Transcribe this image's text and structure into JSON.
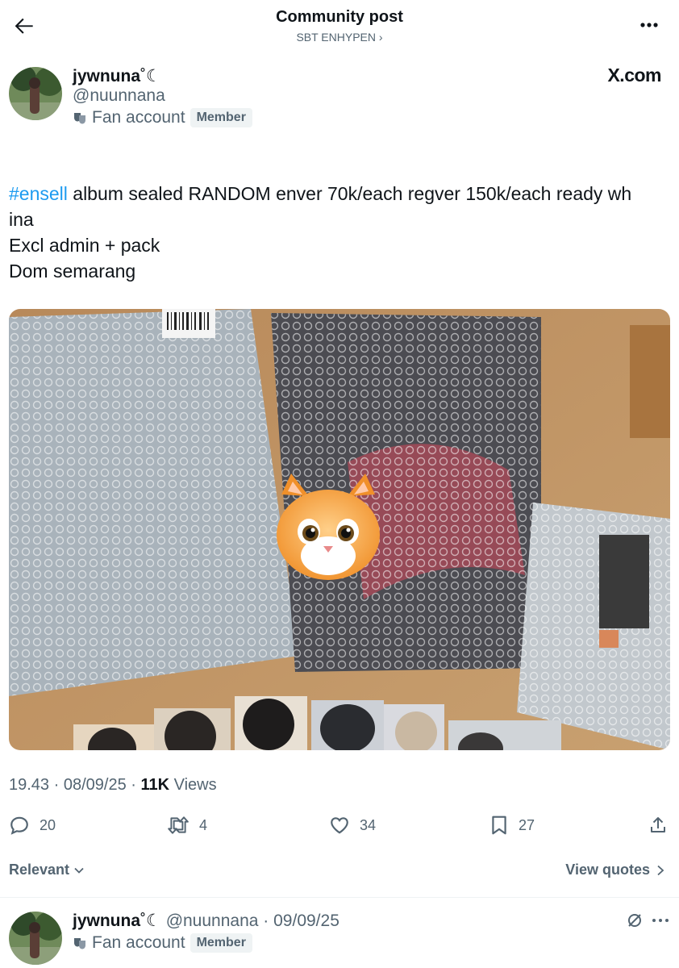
{
  "header": {
    "title": "Community post",
    "subtitle": "SBT ENHYPEN ›"
  },
  "post": {
    "author": {
      "name": "jywnuna",
      "name_glyphs": "˚☾",
      "handle": "@nuunnana",
      "fan_label": "Fan account",
      "badge": "Member"
    },
    "source_label": "X.com",
    "text": {
      "hashtag": "#ensell",
      "line1_rest": " album sealed RANDOM enver 70k/each regver 150k/each ready wh",
      "line2": "ina",
      "line3": "Excl admin + pack",
      "line4": "Dom semarang"
    },
    "meta": {
      "time": "19.43",
      "sep1": " · ",
      "date": "08/09/25",
      "sep2": " · ",
      "views_count": "11K",
      "views_label": " Views"
    },
    "actions": {
      "replies": "20",
      "reposts": "4",
      "likes": "34",
      "bookmarks": "27"
    }
  },
  "replies_bar": {
    "sort_label": "Relevant",
    "view_quotes": "View quotes"
  },
  "reply": {
    "name": "jywnuna",
    "name_glyphs": "˚☾",
    "handle": "@nuunnana",
    "sep": " · ",
    "date": "09/09/25",
    "fan_label": "Fan account",
    "badge": "Member"
  },
  "colors": {
    "accent": "#1d9bf0",
    "muted": "#536471",
    "text": "#0f1419"
  }
}
